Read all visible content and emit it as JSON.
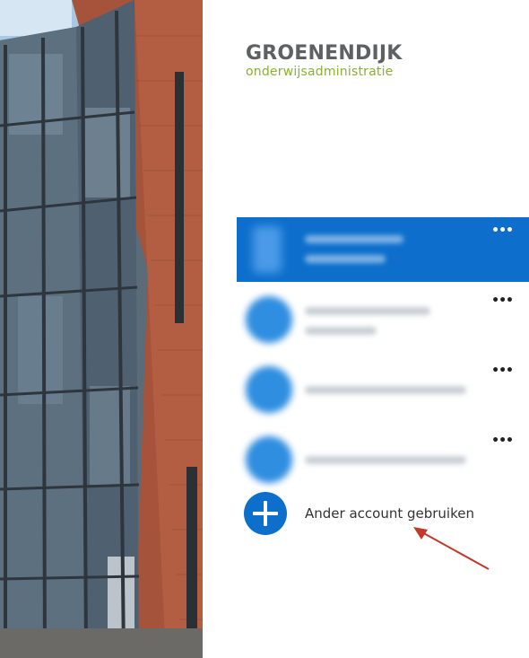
{
  "logo": {
    "brand": "GROENENDIJK",
    "tagline": "onderwijsadministratie"
  },
  "accounts": [
    {
      "selected": true,
      "state": "blurred"
    },
    {
      "selected": false,
      "state": "blurred"
    },
    {
      "selected": false,
      "state": "blurred"
    },
    {
      "selected": false,
      "state": "blurred"
    }
  ],
  "account_menu_glyph": "•••",
  "other_account": {
    "label": "Ander account gebruiken"
  },
  "colors": {
    "accent": "#0d6fcb",
    "brand_green": "#8bb02f",
    "brand_gray": "#5f6062",
    "annotation_arrow": "#c0392b"
  },
  "icons": {
    "plus": "plus-circle-icon",
    "more": "more-dots-icon",
    "avatar": "account-avatar-icon"
  }
}
